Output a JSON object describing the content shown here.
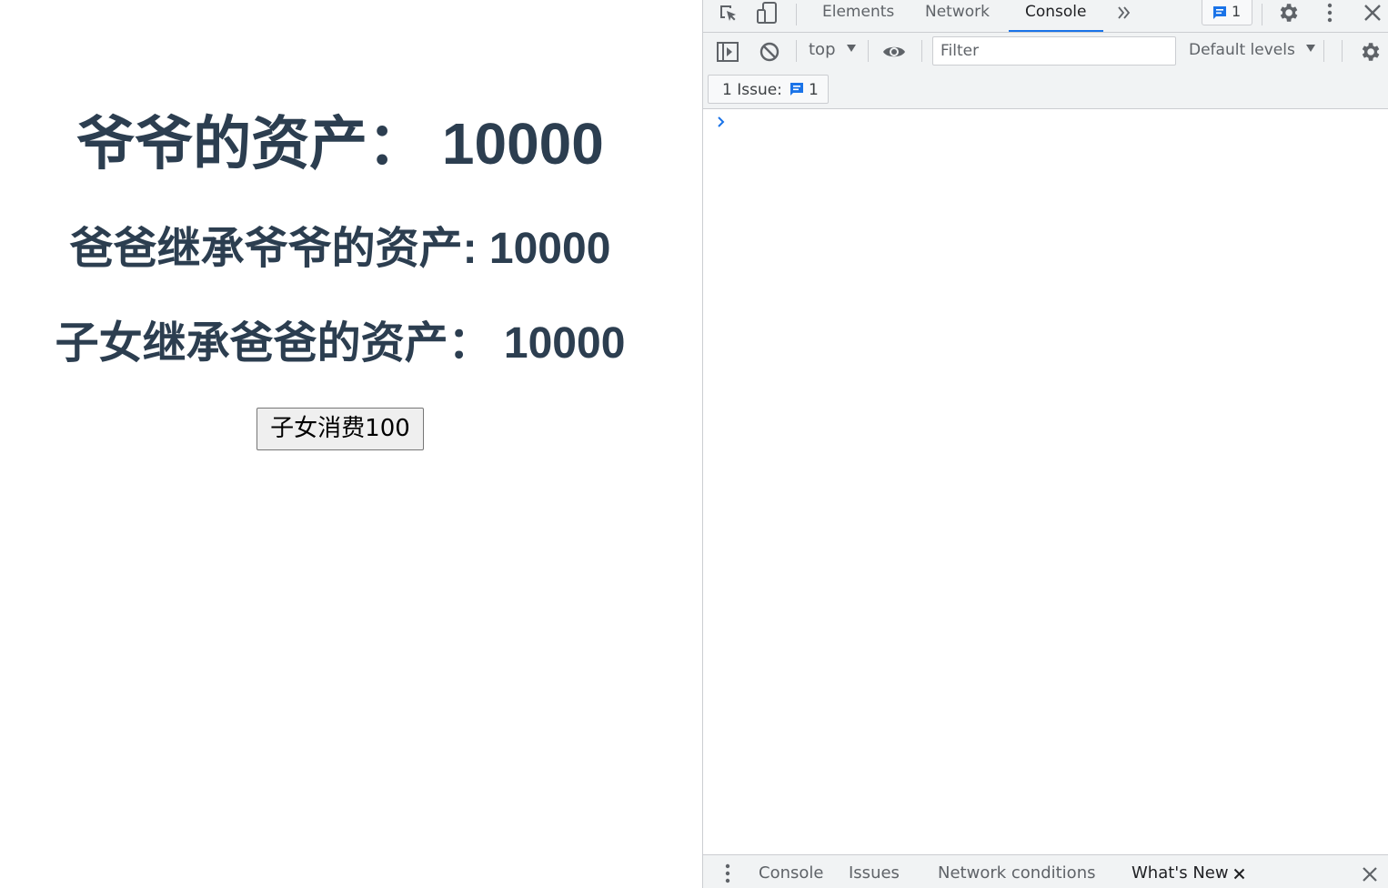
{
  "app": {
    "grandpa_asset": "爷爷的资产：  10000",
    "father_asset": "爸爸继承爷爷的资产: 10000",
    "children_asset": "子女继承爸爸的资产：  10000",
    "spend_button": "子女消费100",
    "heading_color": "#2c3e50"
  },
  "devtools": {
    "tabs": [
      "Elements",
      "Network",
      "Console"
    ],
    "active_tab": "Console",
    "issue_counter": "1",
    "toolbar": {
      "context": "top",
      "filter_placeholder": "Filter",
      "levels": "Default levels"
    },
    "issues_chip": {
      "label": "1 Issue:",
      "count": "1"
    },
    "drawer_tabs": [
      "Console",
      "Issues",
      "Network conditions",
      "What's New"
    ],
    "accent_color": "#1a73e8",
    "icons": [
      "inspect-element-icon",
      "device-toolbar-icon",
      "more-tabs-icon",
      "message-icon",
      "settings-icon",
      "kebab-menu-icon",
      "close-icon",
      "sidebar-toggle-icon",
      "clear-console-icon",
      "dropdown-arrow-icon",
      "eye-icon",
      "console-prompt-icon"
    ]
  }
}
